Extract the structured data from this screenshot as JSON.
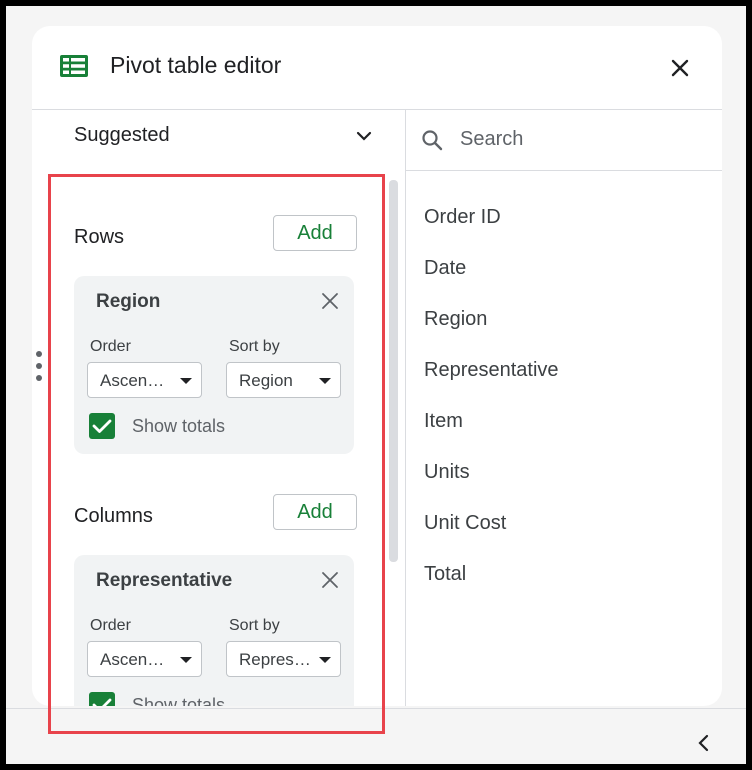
{
  "header": {
    "title": "Pivot table editor"
  },
  "suggested": {
    "label": "Suggested"
  },
  "rows_section": {
    "label": "Rows",
    "add_label": "Add",
    "card": {
      "title": "Region",
      "order_label": "Order",
      "order_value": "Ascending",
      "sort_label": "Sort by",
      "sort_value": "Region",
      "show_totals_label": "Show totals",
      "show_totals_checked": true
    }
  },
  "columns_section": {
    "label": "Columns",
    "add_label": "Add",
    "card": {
      "title": "Representative",
      "order_label": "Order",
      "order_value": "Ascending",
      "sort_label": "Sort by",
      "sort_value": "Representative",
      "show_totals_label": "Show totals",
      "show_totals_checked": true
    }
  },
  "search": {
    "placeholder": "Search",
    "value": ""
  },
  "fields": [
    "Order ID",
    "Date",
    "Region",
    "Representative",
    "Item",
    "Units",
    "Unit Cost",
    "Total"
  ],
  "colors": {
    "accent": "#188038",
    "highlight": "#e8434b",
    "text": "#202124"
  },
  "icons": {
    "app": "sheets-icon",
    "close": "close-icon",
    "chevron": "chevron-down-icon",
    "search": "search-icon",
    "collapse": "chevron-left-icon",
    "drag": "drag-handle-icon"
  }
}
